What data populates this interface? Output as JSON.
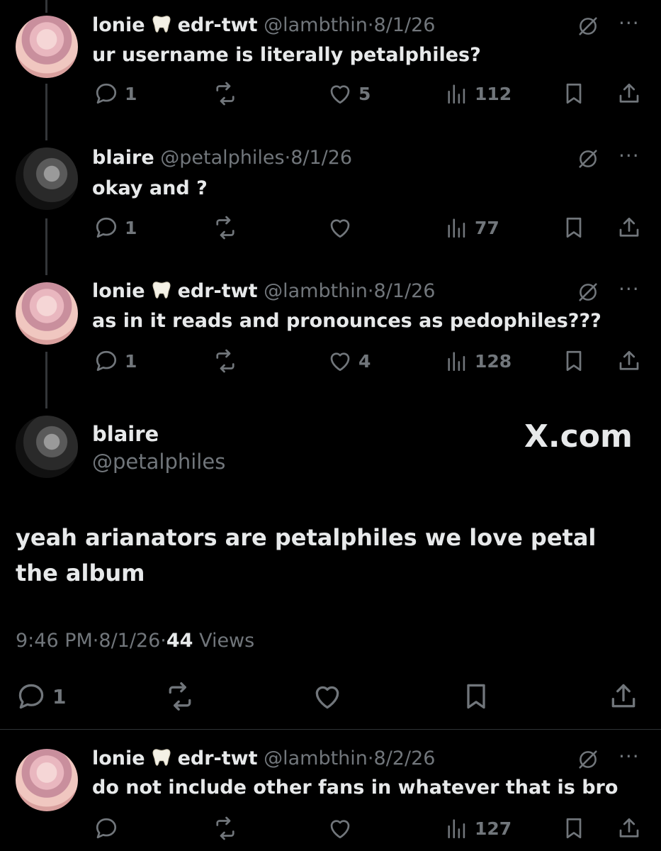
{
  "tweets": [
    {
      "name": "lonie",
      "badge": "edr-twt",
      "handle": "@lambthin",
      "sep": "·",
      "date": "8/1/26",
      "text": "ur username is literally petalphiles?",
      "replies": "1",
      "likes": "5",
      "views": "112"
    },
    {
      "name": "blaire",
      "handle": "@petalphiles",
      "sep": "·",
      "date": "8/1/26",
      "text": "okay and ?",
      "replies": "1",
      "likes": "",
      "views": "77"
    },
    {
      "name": "lonie",
      "badge": "edr-twt",
      "handle": "@lambthin",
      "sep": "·",
      "date": "8/1/26",
      "text": "as in  it reads and pronounces as pedophiles???",
      "replies": "1",
      "likes": "4",
      "views": "128"
    },
    {
      "name": "lonie",
      "badge": "edr-twt",
      "handle": "@lambthin",
      "sep": "·",
      "date": "8/2/26",
      "text": "do not include other fans in whatever that is bro",
      "replies": "",
      "likes": "",
      "views": "127"
    }
  ],
  "main_tweet": {
    "name": "blaire",
    "handle": "@petalphiles",
    "watermark": "X.com",
    "text": "yeah arianators are petalphiles we love petal the album",
    "time": "9:46 PM",
    "date": "8/1/26",
    "views_count": "44",
    "views_label": "Views",
    "sep": "·",
    "replies": "1"
  },
  "more_glyph": "···",
  "icons": {
    "reply": "reply-icon",
    "retweet": "retweet-icon",
    "like": "heart-icon",
    "views": "views-chart-icon",
    "bookmark": "bookmark-icon",
    "share": "share-icon",
    "grok": "grok-icon",
    "tooth": "tooth-emoji"
  },
  "colors": {
    "background": "#000000",
    "text": "#e7e9ea",
    "muted": "#71767b",
    "divider": "#2f3336"
  }
}
